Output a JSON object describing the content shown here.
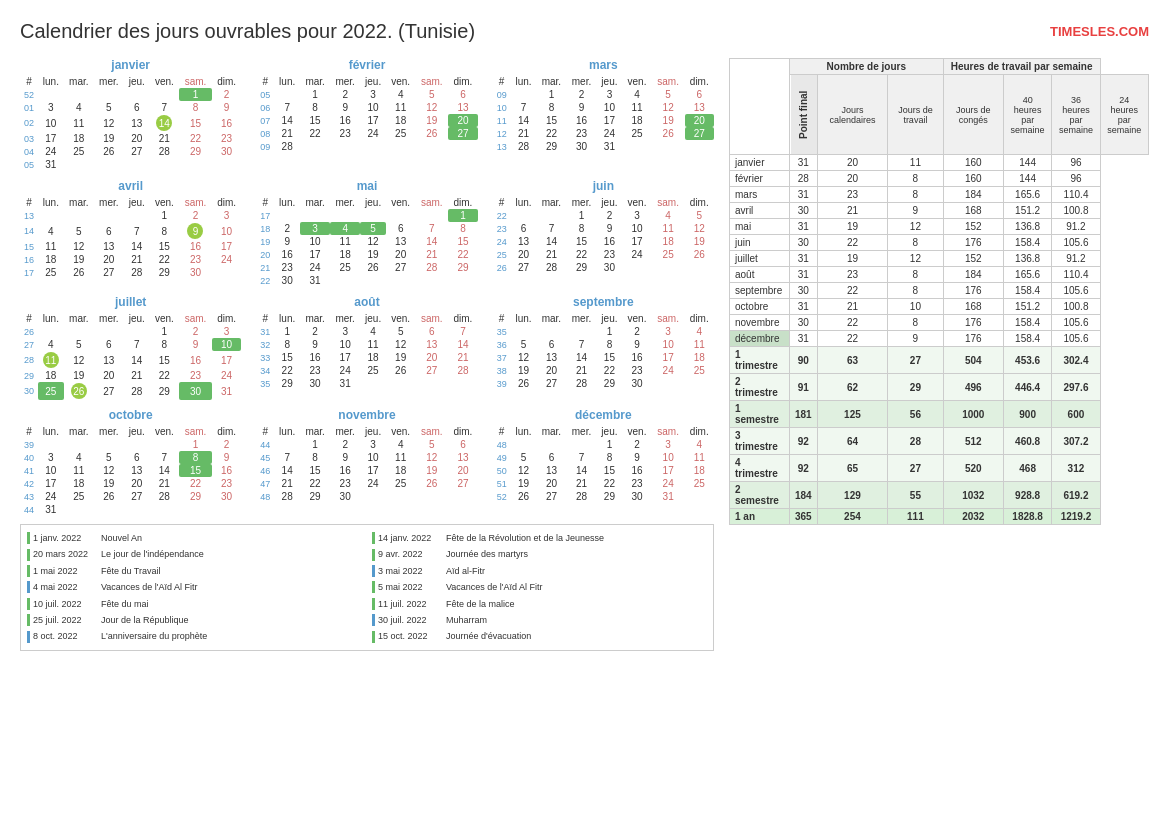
{
  "header": {
    "title": "Calendrier des jours ouvrables pour 2022. (Tunisie)",
    "site": "TIMESLES.COM"
  },
  "months": [
    {
      "name": "janvier",
      "headers": [
        "#",
        "lun.",
        "mar.",
        "mer.",
        "jeu.",
        "ven.",
        "sam.",
        "dim."
      ],
      "rows": [
        [
          "52",
          "",
          "",
          "",
          "",
          "",
          "1",
          "2"
        ],
        [
          "01",
          "3",
          "4",
          "5",
          "6",
          "7",
          "8",
          "9"
        ],
        [
          "02",
          "10",
          "11",
          "12",
          "13",
          "14*",
          "15",
          "16"
        ],
        [
          "03",
          "17",
          "18",
          "19",
          "20",
          "21",
          "22",
          "23"
        ],
        [
          "04",
          "24",
          "25",
          "26",
          "27",
          "28",
          "29",
          "30"
        ],
        [
          "05",
          "31",
          "",
          "",
          "",
          "",
          "",
          ""
        ]
      ],
      "highlights": {
        "1,6": "green",
        "2,7": "red"
      }
    },
    {
      "name": "février",
      "headers": [
        "#",
        "lun.",
        "mar.",
        "mer.",
        "jeu.",
        "ven.",
        "sam.",
        "dim."
      ],
      "rows": [
        [
          "05",
          "",
          "1",
          "2",
          "3",
          "4",
          "5",
          "6"
        ],
        [
          "06",
          "7",
          "8",
          "9",
          "10",
          "11",
          "12",
          "13"
        ],
        [
          "07",
          "14",
          "15",
          "16",
          "17",
          "18",
          "19",
          "20*"
        ],
        [
          "08",
          "21",
          "22",
          "23",
          "24",
          "25",
          "26",
          "27"
        ],
        [
          "09",
          "28",
          "",
          "",
          "",
          "",
          "",
          ""
        ]
      ]
    },
    {
      "name": "mars",
      "headers": [
        "#",
        "lun.",
        "mar.",
        "mer.",
        "jeu.",
        "ven.",
        "sam.",
        "dim."
      ],
      "rows": [
        [
          "09",
          "",
          "1",
          "2",
          "3",
          "4",
          "5",
          "6"
        ],
        [
          "10",
          "7",
          "8",
          "9",
          "10",
          "11",
          "12",
          "13"
        ],
        [
          "11",
          "14",
          "15",
          "16",
          "17",
          "18",
          "19",
          "20*"
        ],
        [
          "12",
          "21",
          "22",
          "23",
          "24",
          "25",
          "26",
          "27"
        ],
        [
          "13",
          "28",
          "29",
          "30",
          "31",
          "",
          "",
          ""
        ]
      ]
    },
    {
      "name": "avril",
      "headers": [
        "#",
        "lun.",
        "mar.",
        "mer.",
        "jeu.",
        "ven.",
        "sam.",
        "dim."
      ],
      "rows": [
        [
          "13",
          "",
          "",
          "",
          "",
          "1",
          "2",
          "3"
        ],
        [
          "14",
          "4",
          "5",
          "6",
          "7",
          "8",
          "9*",
          "10"
        ],
        [
          "15",
          "11",
          "12",
          "13",
          "14",
          "15",
          "16",
          "17"
        ],
        [
          "16",
          "18",
          "19",
          "20",
          "21",
          "22",
          "23",
          "24"
        ],
        [
          "17",
          "25",
          "26",
          "27",
          "28",
          "29",
          "30",
          ""
        ]
      ]
    },
    {
      "name": "mai",
      "headers": [
        "#",
        "lun.",
        "mar.",
        "mer.",
        "jeu.",
        "ven.",
        "sam.",
        "dim."
      ],
      "rows": [
        [
          "17",
          "",
          "",
          "",
          "",
          "",
          "",
          "1*"
        ],
        [
          "18",
          "2",
          "3*",
          "4*",
          "5*",
          "6",
          "7",
          "8"
        ],
        [
          "19",
          "9",
          "10",
          "11",
          "12",
          "13",
          "14",
          "15"
        ],
        [
          "20",
          "16",
          "17",
          "18",
          "19",
          "20",
          "21",
          "22"
        ],
        [
          "21",
          "23",
          "24",
          "25",
          "26",
          "27",
          "28",
          "29"
        ],
        [
          "22",
          "30",
          "31",
          "",
          "",
          "",
          "",
          ""
        ]
      ]
    },
    {
      "name": "juin",
      "headers": [
        "#",
        "lun.",
        "mar.",
        "mer.",
        "jeu.",
        "ven.",
        "sam.",
        "dim."
      ],
      "rows": [
        [
          "22",
          "",
          "",
          "1",
          "2",
          "3",
          "4",
          "5"
        ],
        [
          "23",
          "6",
          "7",
          "8",
          "9",
          "10",
          "11",
          "12"
        ],
        [
          "24",
          "13",
          "14",
          "15",
          "16",
          "17",
          "18",
          "19"
        ],
        [
          "25",
          "20",
          "21",
          "22",
          "23",
          "24",
          "25",
          "26"
        ],
        [
          "26",
          "27",
          "28",
          "29",
          "30",
          "",
          "",
          ""
        ]
      ]
    },
    {
      "name": "juillet",
      "headers": [
        "#",
        "lun.",
        "mar.",
        "mer.",
        "jeu.",
        "ven.",
        "sam.",
        "dim."
      ],
      "rows": [
        [
          "26",
          "",
          "",
          "",
          "",
          "1",
          "2",
          "3"
        ],
        [
          "27",
          "4",
          "5",
          "6",
          "7",
          "8",
          "9",
          "10*"
        ],
        [
          "28",
          "11*",
          "12",
          "13",
          "14",
          "15",
          "16",
          "17"
        ],
        [
          "29",
          "18",
          "19",
          "20",
          "21",
          "22",
          "23",
          "24"
        ],
        [
          "30",
          "25*",
          "26",
          "27",
          "28",
          "29",
          "30*",
          "31"
        ]
      ]
    },
    {
      "name": "août",
      "headers": [
        "#",
        "lun.",
        "mar.",
        "mer.",
        "jeu.",
        "ven.",
        "sam.",
        "dim."
      ],
      "rows": [
        [
          "31",
          "1",
          "2",
          "3",
          "4",
          "5",
          "6",
          "7"
        ],
        [
          "32",
          "8",
          "9",
          "10",
          "11",
          "12",
          "13",
          "14"
        ],
        [
          "33",
          "15",
          "16",
          "17",
          "18",
          "19",
          "20",
          "21"
        ],
        [
          "34",
          "22",
          "23",
          "24",
          "25",
          "26",
          "27",
          "28"
        ],
        [
          "35",
          "29",
          "30",
          "31",
          "",
          "",
          "",
          ""
        ]
      ]
    },
    {
      "name": "septembre",
      "headers": [
        "#",
        "lun.",
        "mar.",
        "mer.",
        "jeu.",
        "ven.",
        "sam.",
        "dim."
      ],
      "rows": [
        [
          "35",
          "",
          "",
          "",
          "1",
          "2",
          "3",
          "4"
        ],
        [
          "36",
          "5",
          "6",
          "7",
          "8",
          "9",
          "10",
          "11"
        ],
        [
          "37",
          "12",
          "13",
          "14",
          "15",
          "16",
          "17",
          "18"
        ],
        [
          "38",
          "19",
          "20",
          "21",
          "22",
          "23",
          "24",
          "25"
        ],
        [
          "39",
          "26",
          "27",
          "28",
          "29",
          "30",
          "",
          ""
        ]
      ]
    },
    {
      "name": "octobre",
      "headers": [
        "#",
        "lun.",
        "mar.",
        "mer.",
        "jeu.",
        "ven.",
        "sam.",
        "dim."
      ],
      "rows": [
        [
          "39",
          "",
          "",
          "",
          "",
          "",
          "1",
          "2"
        ],
        [
          "40",
          "3",
          "4",
          "5",
          "6",
          "7",
          "8*",
          "9"
        ],
        [
          "41",
          "10",
          "11",
          "12",
          "13",
          "14",
          "15*",
          "16"
        ],
        [
          "42",
          "17",
          "18",
          "19",
          "20",
          "21",
          "22",
          "23"
        ],
        [
          "43",
          "24",
          "25",
          "26",
          "27",
          "28",
          "29",
          "30"
        ],
        [
          "44",
          "31",
          "",
          "",
          "",
          "",
          "",
          ""
        ]
      ]
    },
    {
      "name": "novembre",
      "headers": [
        "#",
        "lun.",
        "mar.",
        "mer.",
        "jeu.",
        "ven.",
        "sam.",
        "dim."
      ],
      "rows": [
        [
          "44",
          "",
          "1",
          "2",
          "3",
          "4",
          "5",
          "6"
        ],
        [
          "45",
          "7",
          "8",
          "9",
          "10",
          "11",
          "12",
          "13"
        ],
        [
          "46",
          "14",
          "15",
          "16",
          "17",
          "18",
          "19",
          "20"
        ],
        [
          "47",
          "21",
          "22",
          "23",
          "24",
          "25",
          "26",
          "27"
        ],
        [
          "48",
          "28",
          "29",
          "30",
          "",
          "",
          "",
          ""
        ]
      ]
    },
    {
      "name": "décembre",
      "headers": [
        "#",
        "lun.",
        "mar.",
        "mer.",
        "jeu.",
        "ven.",
        "sam.",
        "dim."
      ],
      "rows": [
        [
          "48",
          "",
          "",
          "",
          "1",
          "2",
          "3",
          "4"
        ],
        [
          "49",
          "5",
          "6",
          "7",
          "8",
          "9",
          "10",
          "11"
        ],
        [
          "50",
          "12",
          "13",
          "14",
          "15",
          "16",
          "17",
          "18"
        ],
        [
          "51",
          "19",
          "20",
          "21",
          "22",
          "23",
          "24",
          "25"
        ],
        [
          "52",
          "26",
          "27",
          "28",
          "29",
          "30",
          "31",
          ""
        ]
      ]
    }
  ],
  "stats": {
    "headers": [
      "",
      "Nombre de jours",
      "",
      "",
      "Heures de travail par semaine",
      "",
      ""
    ],
    "subheaders": [
      "Point final",
      "Jours calendaires",
      "Jours de travail",
      "Jours de congés",
      "40 heures par semaine",
      "36 heures par semaine",
      "24 heures par semaine"
    ],
    "rows": [
      [
        "janvier",
        "31",
        "20",
        "11",
        "160",
        "144",
        "96"
      ],
      [
        "février",
        "28",
        "20",
        "8",
        "160",
        "144",
        "96"
      ],
      [
        "mars",
        "31",
        "23",
        "8",
        "184",
        "165.6",
        "110.4"
      ],
      [
        "avril",
        "30",
        "21",
        "9",
        "168",
        "151.2",
        "100.8"
      ],
      [
        "mai",
        "31",
        "19",
        "12",
        "152",
        "136.8",
        "91.2"
      ],
      [
        "juin",
        "30",
        "22",
        "8",
        "176",
        "158.4",
        "105.6"
      ],
      [
        "juillet",
        "31",
        "19",
        "12",
        "152",
        "136.8",
        "91.2"
      ],
      [
        "août",
        "31",
        "23",
        "8",
        "184",
        "165.6",
        "110.4"
      ],
      [
        "septembre",
        "30",
        "22",
        "8",
        "176",
        "158.4",
        "105.6"
      ],
      [
        "octobre",
        "31",
        "21",
        "10",
        "168",
        "151.2",
        "100.8"
      ],
      [
        "novembre",
        "30",
        "22",
        "8",
        "176",
        "158.4",
        "105.6"
      ],
      [
        "décembre",
        "31",
        "22",
        "9",
        "176",
        "158.4",
        "105.6"
      ],
      [
        "1 trimestre",
        "90",
        "63",
        "27",
        "504",
        "453.6",
        "302.4"
      ],
      [
        "2 trimestre",
        "91",
        "62",
        "29",
        "496",
        "446.4",
        "297.6"
      ],
      [
        "1 semestre",
        "181",
        "125",
        "56",
        "1000",
        "900",
        "600"
      ],
      [
        "3 trimestre",
        "92",
        "64",
        "28",
        "512",
        "460.8",
        "307.2"
      ],
      [
        "4 trimestre",
        "92",
        "65",
        "27",
        "520",
        "468",
        "312"
      ],
      [
        "2 semestre",
        "184",
        "129",
        "55",
        "1032",
        "928.8",
        "619.2"
      ],
      [
        "1 an",
        "365",
        "254",
        "111",
        "2032",
        "1828.8",
        "1219.2"
      ]
    ]
  },
  "holidays": [
    {
      "date": "1 janv. 2022",
      "name": "Nouvel An",
      "color": "green"
    },
    {
      "date": "14 janv. 2022",
      "name": "Fête de la Révolution et de la Jeunesse",
      "color": "green"
    },
    {
      "date": "20 mars 2022",
      "name": "Le jour de l'indépendance",
      "color": "green"
    },
    {
      "date": "9 avr. 2022",
      "name": "Journée des martyrs",
      "color": "green"
    },
    {
      "date": "1 mai 2022",
      "name": "Fête du Travail",
      "color": "green"
    },
    {
      "date": "3 mai 2022",
      "name": "Aïd al-Fitr",
      "color": "blue"
    },
    {
      "date": "4 mai 2022",
      "name": "Vacances de l'Aïd Al Fitr",
      "color": "blue"
    },
    {
      "date": "5 mai 2022",
      "name": "Vacances de l'Aïd Al Fitr",
      "color": "green"
    },
    {
      "date": "10 juil. 2022",
      "name": "Fête du mai",
      "color": "green"
    },
    {
      "date": "11 juil. 2022",
      "name": "Fête de la malice",
      "color": "green"
    },
    {
      "date": "25 juil. 2022",
      "name": "Jour de la République",
      "color": "green"
    },
    {
      "date": "30 juil. 2022",
      "name": "Muharram",
      "color": "blue"
    },
    {
      "date": "8 oct. 2022",
      "name": "L'anniversaire du prophète",
      "color": "blue"
    },
    {
      "date": "15 oct. 2022",
      "name": "Journée d'évacuation",
      "color": "green"
    }
  ]
}
